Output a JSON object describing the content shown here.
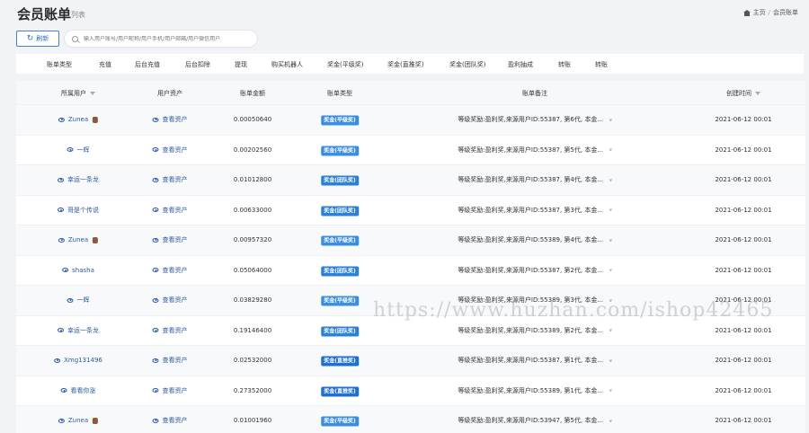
{
  "header": {
    "title": "会员账单",
    "subtitle": "列表"
  },
  "breadcrumb": {
    "home": "主页",
    "current": "会员账单"
  },
  "toolbar": {
    "refresh_label": "刷新",
    "search_placeholder": "输入用户账号/用户昵称/用户手机/用户邮箱/用户微信用户"
  },
  "tabs": [
    "账单类型",
    "充值",
    "后台充值",
    "后台扣除",
    "提现",
    "购买机器人",
    "奖金(平级奖)",
    "奖金(直推奖)",
    "奖金(团队奖)",
    "盈利抽成",
    "转账",
    "转账"
  ],
  "columns": [
    "所属用户",
    "用户资产",
    "账单金额",
    "账单类型",
    "账单备注",
    "创建时间"
  ],
  "colors": {
    "accent": "#2d6bc4",
    "badge_level": "#3a8ee0",
    "badge_team": "#2a7fd9",
    "badge_direct": "#1e6fd0"
  },
  "rows": [
    {
      "user": "Zunea",
      "avatar": true,
      "asset": "查看资产",
      "amount": "0.00050640",
      "type": "奖金(平级奖)",
      "remark": "等级奖励:盈利奖,来源用户ID:55387, 第6代, 本金...",
      "time": "2021-06-12 00:01"
    },
    {
      "user": "一辉",
      "avatar": false,
      "asset": "查看资产",
      "amount": "0.00202560",
      "type": "奖金(平级奖)",
      "remark": "等级奖励:盈利奖,来源用户ID:55387, 第5代, 本金...",
      "time": "2021-06-12 00:01"
    },
    {
      "user": "幸运一条龙",
      "avatar": false,
      "asset": "查看资产",
      "amount": "0.01012800",
      "type": "奖金(团队奖)",
      "remark": "等级奖励:盈利奖,来源用户ID:55387, 第4代, 本金...",
      "time": "2021-06-12 00:01"
    },
    {
      "user": "哥是个传说",
      "avatar": false,
      "asset": "查看资产",
      "amount": "0.00633000",
      "type": "奖金(团队奖)",
      "remark": "等级奖励:盈利奖,来源用户ID:55387, 第3代, 本金...",
      "time": "2021-06-12 00:01"
    },
    {
      "user": "Zunea",
      "avatar": true,
      "asset": "查看资产",
      "amount": "0.00957320",
      "type": "奖金(平级奖)",
      "remark": "等级奖励:盈利奖,来源用户ID:55389, 第4代, 本金...",
      "time": "2021-06-12 00:01"
    },
    {
      "user": "shasha",
      "avatar": false,
      "asset": "查看资产",
      "amount": "0.05064000",
      "type": "奖金(团队奖)",
      "remark": "等级奖励:盈利奖,来源用户ID:55387, 第2代, 本金...",
      "time": "2021-06-12 00:01"
    },
    {
      "user": "一辉",
      "avatar": false,
      "asset": "查看资产",
      "amount": "0.03829280",
      "type": "奖金(平级奖)",
      "remark": "等级奖励:盈利奖,来源用户ID:55389, 第3代, 本金...",
      "time": "2021-06-12 00:01"
    },
    {
      "user": "幸运一条龙",
      "avatar": false,
      "asset": "查看资产",
      "amount": "0.19146400",
      "type": "奖金(团队奖)",
      "remark": "等级奖励:盈利奖,来源用户ID:55389, 第2代, 本金...",
      "time": "2021-06-12 00:01"
    },
    {
      "user": "Xmg131496",
      "avatar": false,
      "asset": "查看资产",
      "amount": "0.02532000",
      "type": "奖金(直推奖)",
      "remark": "等级奖励:盈利奖,来源用户ID:55387, 第1代, 本金...",
      "time": "2021-06-12 00:01"
    },
    {
      "user": "看看你涨",
      "avatar": false,
      "asset": "查看资产",
      "amount": "0.27352000",
      "type": "奖金(直推奖)",
      "remark": "等级奖励:盈利奖,来源用户ID:55389, 第1代, 本金...",
      "time": "2021-06-12 00:01"
    },
    {
      "user": "Zunea",
      "avatar": true,
      "asset": "查看资产",
      "amount": "0.01001960",
      "type": "奖金(平级奖)",
      "remark": "等级奖励:盈利奖,来源用户ID:53947, 第5代, 本金...",
      "time": "2021-06-12 00:01"
    }
  ],
  "watermark": "https://www.huzhan.com/ishop42465"
}
